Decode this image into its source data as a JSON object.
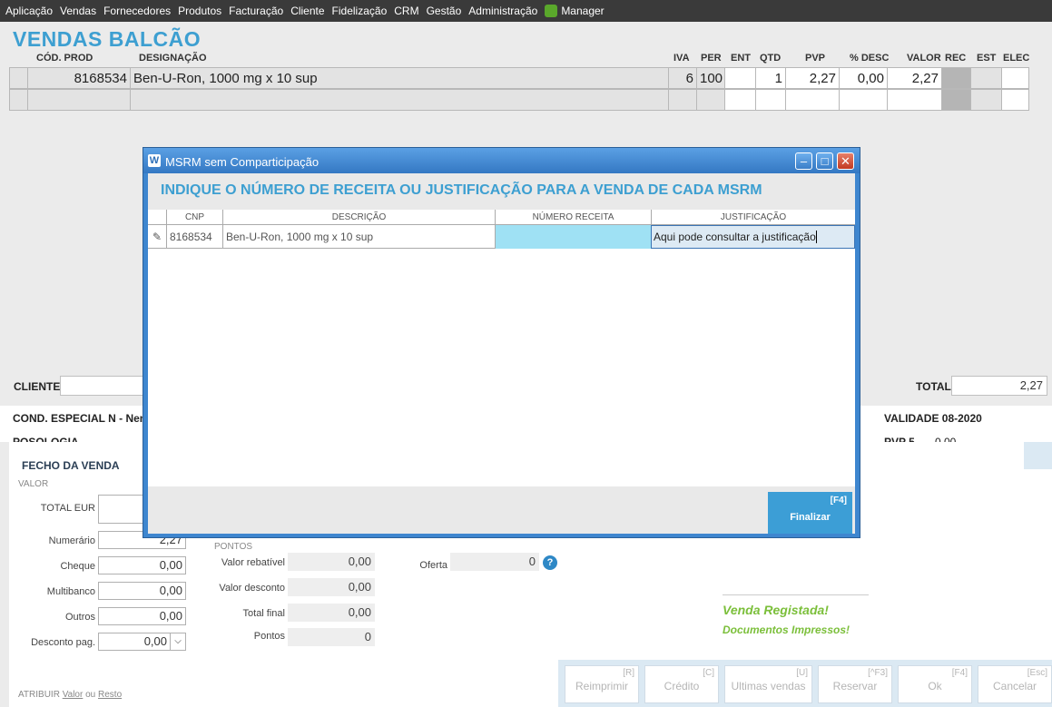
{
  "menu": {
    "items": [
      "Aplicação",
      "Vendas",
      "Fornecedores",
      "Produtos",
      "Facturação",
      "Cliente",
      "Fidelização",
      "CRM",
      "Gestão",
      "Administração"
    ],
    "manager": "Manager"
  },
  "page_title": "VENDAS BALCÃO",
  "main_table": {
    "headers": {
      "cod": "CÓD. PROD",
      "designacao": "DESIGNAÇÃO",
      "iva": "IVA",
      "per": "PER",
      "ent": "ENT",
      "qtd": "QTD",
      "pvp": "PVP",
      "desc": "% DESC",
      "valor": "VALOR",
      "rec": "REC",
      "est": "EST",
      "elec": "ELEC"
    },
    "row": {
      "cod": "8168534",
      "designacao": "Ben-U-Ron, 1000 mg x 10 sup",
      "iva": "6",
      "per": "100",
      "ent": "",
      "qtd": "1",
      "pvp": "2,27",
      "desc": "0,00",
      "valor": "2,27"
    }
  },
  "cliente_label": "CLIENTE",
  "total_label": "TOTAL",
  "total_value": "2,27",
  "cond_especial": "COND. ESPECIAL N - Nen",
  "validade": "VALIDADE 08-2020",
  "posologia": "POSOLOGIA",
  "pvp5": "PVP 5",
  "pvp5_value": "0,00",
  "fecho": {
    "title": "FECHO DA VENDA",
    "valor_heading": "VALOR",
    "total_eur": "TOTAL EUR",
    "numerario": "Numerário",
    "numerario_value": "2,27",
    "cheque": "Cheque",
    "cheque_value": "0,00",
    "multibanco": "Multibanco",
    "multibanco_value": "0,00",
    "outros": "Outros",
    "outros_value": "0,00",
    "desconto_pag": "Desconto pag.",
    "desconto_pag_value": "0,00",
    "atribuir": "ATRIBUIR",
    "valor_link": "Valor",
    "ou": "ou",
    "resto_link": "Resto",
    "pontos_heading": "PONTOS",
    "valor_rebativel": "Valor rebatível",
    "valor_rebativel_value": "0,00",
    "valor_desconto": "Valor desconto",
    "valor_desconto_value": "0,00",
    "total_final": "Total final",
    "total_final_value": "0,00",
    "pontos": "Pontos",
    "pontos_value": "0",
    "oferta": "Oferta",
    "oferta_value": "0",
    "venda_registada": "Venda Registada!",
    "documentos_impressos": "Documentos Impressos!"
  },
  "buttons": [
    {
      "key": "[R]",
      "label": "Reimprimir"
    },
    {
      "key": "[C]",
      "label": "Crédito"
    },
    {
      "key": "[U]",
      "label": "Ultimas vendas"
    },
    {
      "key": "[^F3]",
      "label": "Reservar"
    },
    {
      "key": "[F4]",
      "label": "Ok"
    },
    {
      "key": "[Esc]",
      "label": "Cancelar"
    }
  ],
  "dialog": {
    "title": "MSRM sem Comparticipação",
    "heading": "INDIQUE O NÚMERO DE RECEITA OU JUSTIFICAÇÃO PARA A VENDA DE CADA MSRM",
    "columns": {
      "cnp": "CNP",
      "descricao": "DESCRIÇÃO",
      "numero_receita": "NÚMERO RECEITA",
      "justificacao": "JUSTIFICAÇÃO"
    },
    "row": {
      "cnp": "8168534",
      "descricao": "Ben-U-Ron, 1000 mg x 10 sup",
      "numero_receita": "",
      "justificacao": "Aqui pode consultar a justificação"
    },
    "finalizar_key": "[F4]",
    "finalizar_label": "Finalizar"
  },
  "colors": {
    "accent": "#3d9fd1",
    "green": "#7bbf3a",
    "dialog_frame": "#3e86cf"
  }
}
